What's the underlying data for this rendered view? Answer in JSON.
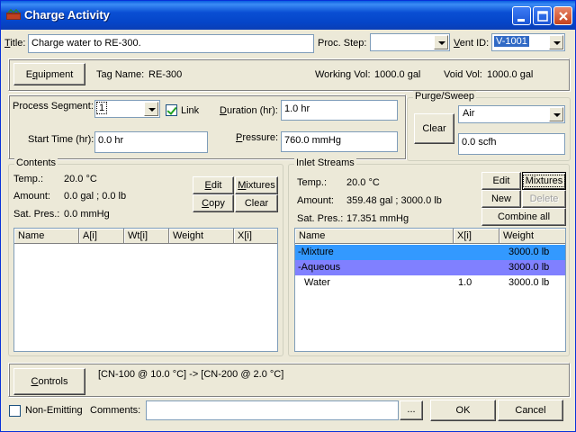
{
  "window": {
    "title": "Charge Activity"
  },
  "header": {
    "title_label": "Title:",
    "title_value": "Charge water to RE-300.",
    "proc_step_label": "Proc. Step:",
    "proc_step_value": "",
    "vent_id_label": "Vent ID:",
    "vent_id_value": "V-1001"
  },
  "equipment": {
    "button_label": "Equipment",
    "tag_name_label": "Tag Name:",
    "tag_name_value": "RE-300",
    "working_vol_label": "Working Vol:",
    "working_vol_value": "1000.0 gal",
    "void_vol_label": "Void Vol:",
    "void_vol_value": "1000.0 gal"
  },
  "process": {
    "segment_label": "Process Segment:",
    "segment_value": "1",
    "link_label": "Link",
    "link_checked": true,
    "duration_label": "Duration (hr):",
    "duration_value": "1.0 hr",
    "start_time_label": "Start Time (hr):",
    "start_time_value": "0.0 hr",
    "pressure_label": "Pressure:",
    "pressure_value": "760.0 mmHg"
  },
  "purge": {
    "group_label": "Purge/Sweep",
    "clear_label": "Clear",
    "gas_value": "Air",
    "flow_value": "0.0 scfh"
  },
  "contents": {
    "group_label": "Contents",
    "temp_label": "Temp.:",
    "temp_value": "20.0 °C",
    "amount_label": "Amount:",
    "amount_value": "0.0 gal ; 0.0 lb",
    "satpres_label": "Sat. Pres.:",
    "satpres_value": "0.0 mmHg",
    "buttons": {
      "edit": "Edit",
      "mixtures": "Mixtures",
      "copy": "Copy",
      "clear": "Clear"
    },
    "columns": [
      "Name",
      "A[i]",
      "Wt[i]",
      "Weight",
      "X[i]"
    ]
  },
  "inlet": {
    "group_label": "Inlet Streams",
    "temp_label": "Temp.:",
    "temp_value": "20.0 °C",
    "amount_label": "Amount:",
    "amount_value": "359.48 gal ; 3000.0 lb",
    "satpres_label": "Sat. Pres.:",
    "satpres_value": "17.351 mmHg",
    "buttons": {
      "edit": "Edit",
      "mixtures": "Mixtures",
      "new": "New",
      "delete": "Delete",
      "combine_all": "Combine all"
    },
    "columns": [
      "Name",
      "X[i]",
      "Weight"
    ],
    "rows": [
      {
        "name": "-Mixture",
        "x": "",
        "weight": "3000.0 lb"
      },
      {
        "name": "-Aqueous",
        "x": "",
        "weight": "3000.0 lb"
      },
      {
        "name": "Water",
        "x": "1.0",
        "weight": "3000.0 lb"
      }
    ],
    "row_colors": [
      "#3399ff",
      "#8080ff",
      "#ffffff"
    ]
  },
  "controls": {
    "button_label": "Controls",
    "summary": "[CN-100 @ 10.0 °C]  -> [CN-200 @ 2.0 °C]"
  },
  "footer": {
    "non_emitting_label": "Non-Emitting",
    "non_emitting_checked": false,
    "comments_label": "Comments:",
    "comments_value": "",
    "browse_label": "...",
    "ok_label": "OK",
    "cancel_label": "Cancel"
  }
}
